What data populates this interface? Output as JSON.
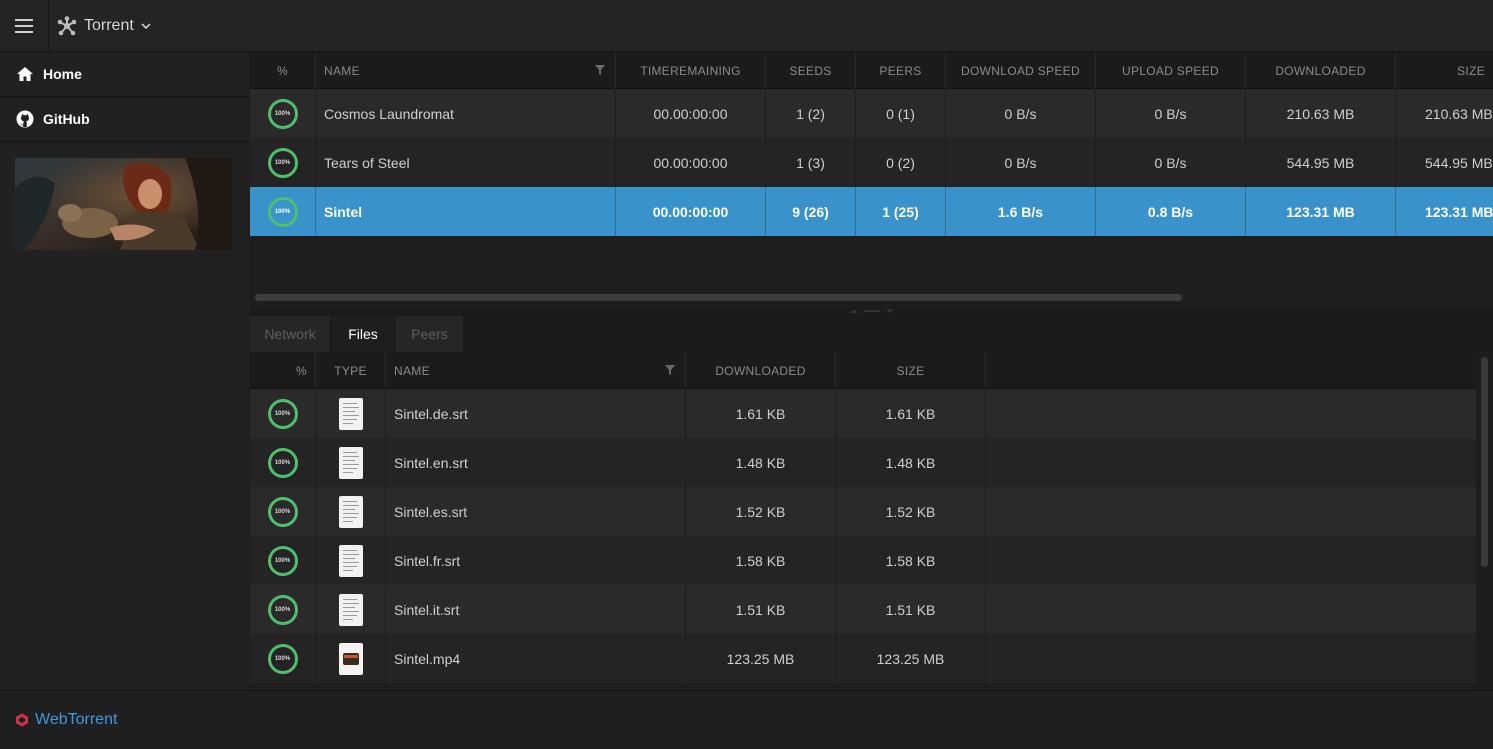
{
  "topbar": {
    "menu_icon": "hamburger-icon",
    "app_icon": "network-icon",
    "title": "Torrent",
    "dropdown_icon": "chevron-down-icon"
  },
  "sidebar": {
    "items": [
      {
        "label": "Home",
        "icon": "home-icon"
      },
      {
        "label": "GitHub",
        "icon": "github-icon"
      }
    ]
  },
  "torrents": {
    "headers": [
      "%",
      "NAME",
      "TIMEREMAINING",
      "SEEDS",
      "PEERS",
      "DOWNLOAD SPEED",
      "UPLOAD SPEED",
      "DOWNLOADED",
      "SIZE"
    ],
    "rows": [
      {
        "progress": "100%",
        "name": "Cosmos Laundromat",
        "time": "00.00:00:00",
        "seeds": "1 (2)",
        "peers": "0 (1)",
        "down": "0 B/s",
        "up": "0 B/s",
        "downloaded": "210.63 MB",
        "size": "210.63 MB"
      },
      {
        "progress": "100%",
        "name": "Tears of Steel",
        "time": "00.00:00:00",
        "seeds": "1 (3)",
        "peers": "0 (2)",
        "down": "0 B/s",
        "up": "0 B/s",
        "downloaded": "544.95 MB",
        "size": "544.95 MB"
      },
      {
        "progress": "100%",
        "name": "Sintel",
        "time": "00.00:00:00",
        "seeds": "9 (26)",
        "peers": "1 (25)",
        "down": "1.6 B/s",
        "up": "0.8 B/s",
        "downloaded": "123.31 MB",
        "size": "123.31 MB"
      }
    ],
    "selected_index": 2
  },
  "tabs": [
    "Network",
    "Files",
    "Peers"
  ],
  "active_tab": "Files",
  "files": {
    "headers": [
      "%",
      "TYPE",
      "NAME",
      "DOWNLOADED",
      "SIZE"
    ],
    "rows": [
      {
        "progress": "100%",
        "type": "text-file-icon",
        "name": "Sintel.de.srt",
        "downloaded": "1.61 KB",
        "size": "1.61 KB"
      },
      {
        "progress": "100%",
        "type": "text-file-icon",
        "name": "Sintel.en.srt",
        "downloaded": "1.48 KB",
        "size": "1.48 KB"
      },
      {
        "progress": "100%",
        "type": "text-file-icon",
        "name": "Sintel.es.srt",
        "downloaded": "1.52 KB",
        "size": "1.52 KB"
      },
      {
        "progress": "100%",
        "type": "text-file-icon",
        "name": "Sintel.fr.srt",
        "downloaded": "1.58 KB",
        "size": "1.58 KB"
      },
      {
        "progress": "100%",
        "type": "text-file-icon",
        "name": "Sintel.it.srt",
        "downloaded": "1.51 KB",
        "size": "1.51 KB"
      },
      {
        "progress": "100%",
        "type": "video-file-icon",
        "name": "Sintel.mp4",
        "downloaded": "123.25 MB",
        "size": "123.25 MB"
      }
    ]
  },
  "footer": {
    "label": "WebTorrent",
    "icon": "webtorrent-logo-icon"
  },
  "colors": {
    "accent": "#3a92cb",
    "progress": "#4fbf6b",
    "link": "#3a9ae2"
  }
}
